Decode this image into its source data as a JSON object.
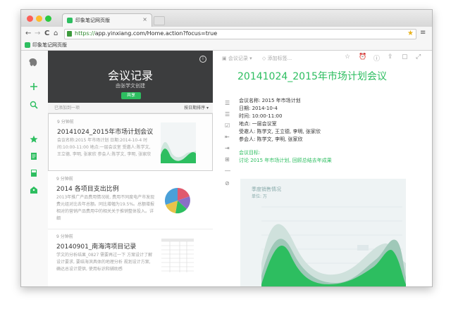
{
  "browser": {
    "tab_title": "印象笔记网页版",
    "tab_close": "×",
    "url_protocol": "https://",
    "url_rest": "app.yinxiang.com/Home.action?focus=true",
    "bookmark_label": "印象笔记网页版",
    "nav": {
      "back": "←",
      "forward": "→",
      "reload": "C",
      "home": "⌂",
      "star": "★",
      "menu": "≡"
    }
  },
  "rail": {
    "icons": [
      "elephant-logo-icon",
      "plus-icon",
      "search-icon",
      "star-icon",
      "note-icon",
      "notebook-icon",
      "tag-icon"
    ]
  },
  "notebook": {
    "title": "会议记录",
    "subtitle": "由张学文创建",
    "share_label": "共享",
    "info": "i",
    "toolbar_left": "已添加到一项",
    "toolbar_right": "按日期排序 ▾"
  },
  "notes": [
    {
      "time": "9 分钟前",
      "title": "20141024_2015年市场计划会议",
      "snippet": "会议名称:2015 年市场计划 日期:2014-10-4 时间:10:00-11:00 地点:一层会议室 受邀人:陈学文, 王立德, 李明, 张家欣 参会人:陈学文, 李明, 张家欣"
    },
    {
      "time": "9 分钟前",
      "title": "2014 各项目支出比例",
      "snippet": "2013年推广产品费用情况统, 费用不同度电产市发现费元组对比去年总额。同比增幅为19.5%。总额增报相对的营销产品费用中的相关关于推销整体投入。详细"
    },
    {
      "time": "9 分钟前",
      "title": "20140901_南海湾项目记录",
      "snippet": "学文的分析结果_0827 需要再过一下 方案设计了解设计要求, 要结海滨具体的地理分析 规划设计方案, 确达总设计提供, 使用标识和辅助感"
    }
  ],
  "reader": {
    "tool_notebook": "会议记录",
    "tool_tags": "添加标签...",
    "title": "20141024_2015年市场计划会议",
    "meta": [
      "会议名称: 2015 年市场计划",
      "日期: 2014-10-4",
      "时间: 10:00-11:00",
      "地点: 一层会议室",
      "受邀人: 陈学文, 王立德, 李明, 张家欣",
      "参会人: 陈学文, 李明, 张家欣"
    ],
    "goal_label": "会议目标:",
    "goal_text": "讨论 2015 年市场计划, 回顾总结去年成果",
    "chart_title": "季度销售情况",
    "chart_sub": "单位: 万"
  },
  "colors": {
    "accent": "#2dbe60",
    "banner": "#3c3d3e",
    "traffic_red": "#fc5f57",
    "traffic_yellow": "#fdbc2e",
    "traffic_green": "#2bc840"
  }
}
